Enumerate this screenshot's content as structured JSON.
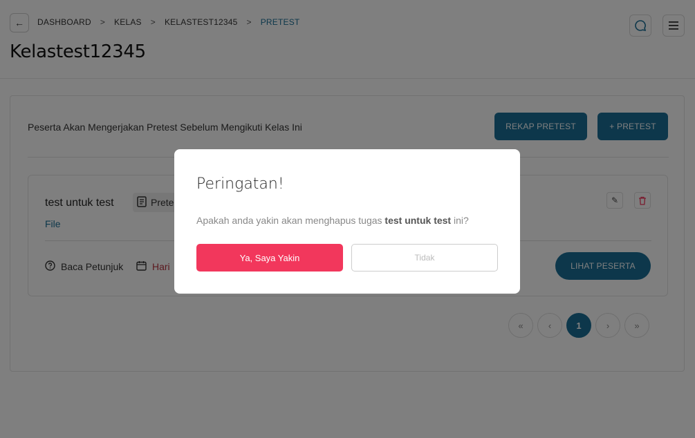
{
  "header": {
    "breadcrumb": [
      "DASHBOARD",
      "KELAS",
      "KELASTEST12345",
      "PRETEST"
    ],
    "title": "Kelastest12345"
  },
  "card": {
    "description": "Peserta Akan Mengerjakan Pretest Sebelum Mengikuti Kelas Ini",
    "rekap_label": "REKAP PRETEST",
    "add_label": "+ PRETEST"
  },
  "test": {
    "name": "test untuk test",
    "badge": "Pretest",
    "file_label": "File",
    "petunjuk_label": "Baca Petunjuk",
    "deadline_label": "Hari",
    "lihat_label": "LIHAT PESERTA"
  },
  "pagination": {
    "first": "«",
    "prev": "‹",
    "current": "1",
    "next": "›",
    "last": "»"
  },
  "modal": {
    "title": "Peringatan!",
    "message_prefix": "Apakah anda yakin akan menghapus tugas ",
    "message_bold": "test untuk test",
    "message_suffix": " ini?",
    "yes_label": "Ya, Saya Yakin",
    "no_label": "Tidak"
  },
  "colors": {
    "primary": "#1a6f96",
    "danger": "#f2375c",
    "deadline": "#b7333f"
  }
}
